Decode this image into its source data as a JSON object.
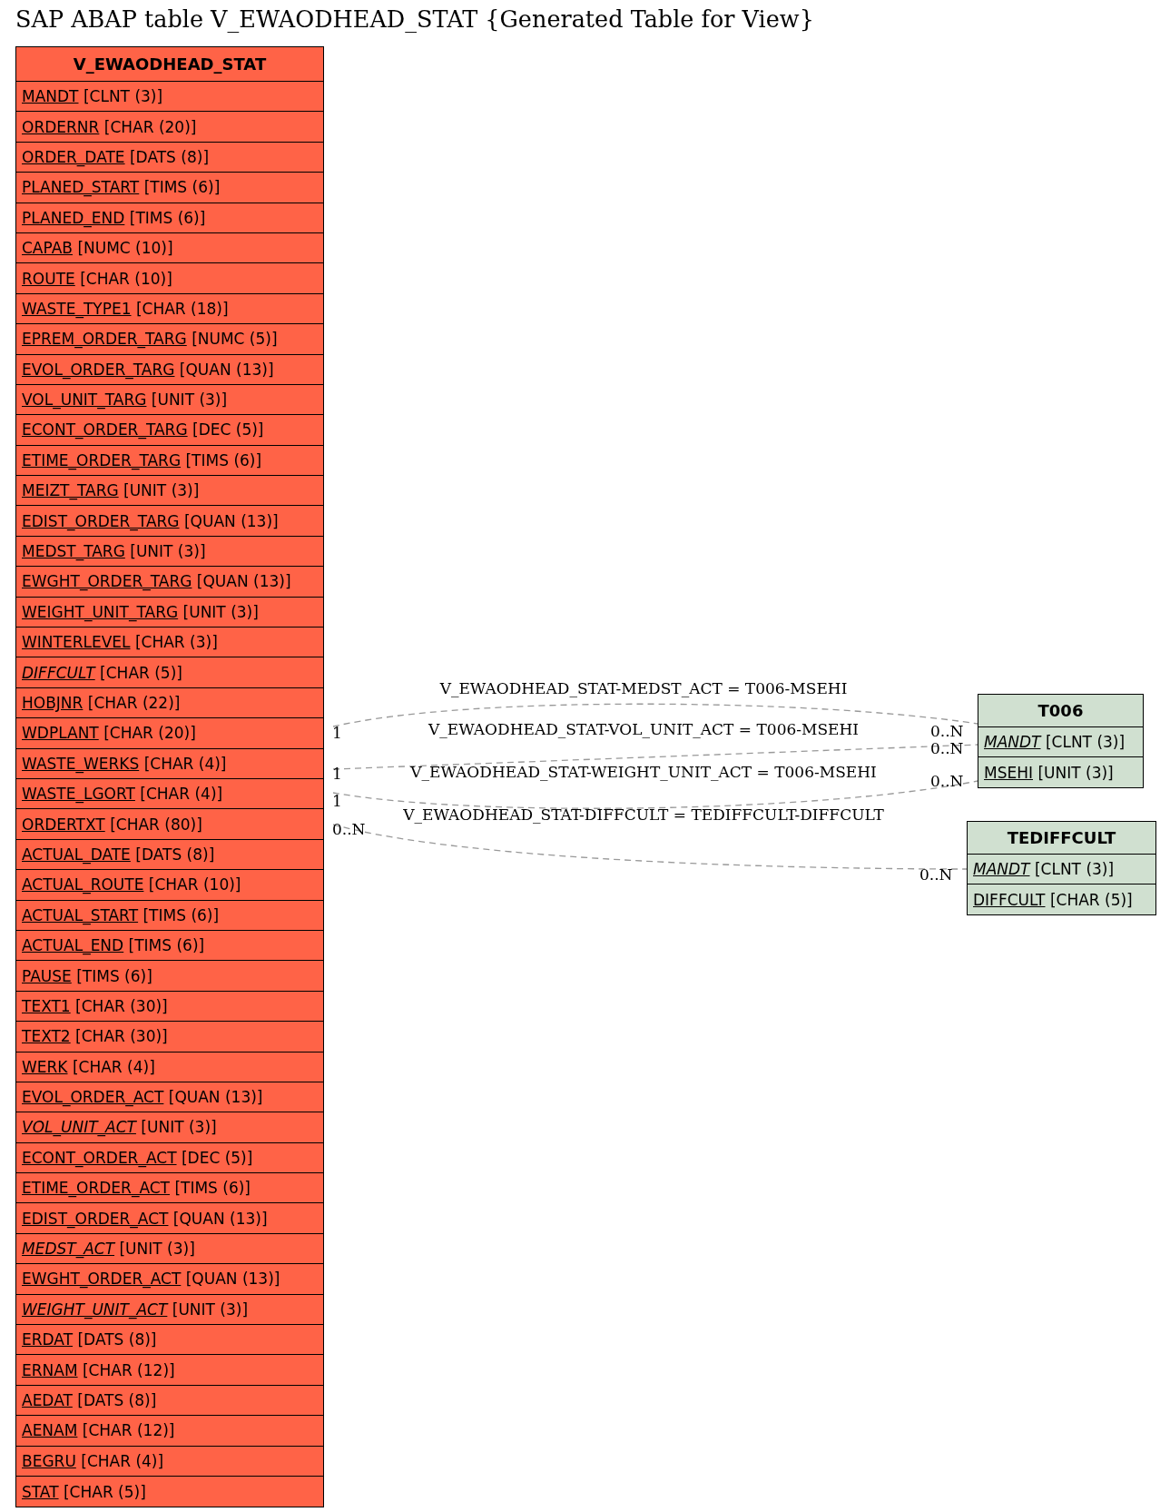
{
  "title": "SAP ABAP table V_EWAODHEAD_STAT {Generated Table for View}",
  "main_table": {
    "name": "V_EWAODHEAD_STAT",
    "fields": [
      {
        "name": "MANDT",
        "type": "[CLNT (3)]",
        "italic": false
      },
      {
        "name": "ORDERNR",
        "type": "[CHAR (20)]",
        "italic": false
      },
      {
        "name": "ORDER_DATE",
        "type": "[DATS (8)]",
        "italic": false
      },
      {
        "name": "PLANED_START",
        "type": "[TIMS (6)]",
        "italic": false
      },
      {
        "name": "PLANED_END",
        "type": "[TIMS (6)]",
        "italic": false
      },
      {
        "name": "CAPAB",
        "type": "[NUMC (10)]",
        "italic": false
      },
      {
        "name": "ROUTE",
        "type": "[CHAR (10)]",
        "italic": false
      },
      {
        "name": "WASTE_TYPE1",
        "type": "[CHAR (18)]",
        "italic": false
      },
      {
        "name": "EPREM_ORDER_TARG",
        "type": "[NUMC (5)]",
        "italic": false
      },
      {
        "name": "EVOL_ORDER_TARG",
        "type": "[QUAN (13)]",
        "italic": false
      },
      {
        "name": "VOL_UNIT_TARG",
        "type": "[UNIT (3)]",
        "italic": false
      },
      {
        "name": "ECONT_ORDER_TARG",
        "type": "[DEC (5)]",
        "italic": false
      },
      {
        "name": "ETIME_ORDER_TARG",
        "type": "[TIMS (6)]",
        "italic": false
      },
      {
        "name": "MEIZT_TARG",
        "type": "[UNIT (3)]",
        "italic": false
      },
      {
        "name": "EDIST_ORDER_TARG",
        "type": "[QUAN (13)]",
        "italic": false
      },
      {
        "name": "MEDST_TARG",
        "type": "[UNIT (3)]",
        "italic": false
      },
      {
        "name": "EWGHT_ORDER_TARG",
        "type": "[QUAN (13)]",
        "italic": false
      },
      {
        "name": "WEIGHT_UNIT_TARG",
        "type": "[UNIT (3)]",
        "italic": false
      },
      {
        "name": "WINTERLEVEL",
        "type": "[CHAR (3)]",
        "italic": false
      },
      {
        "name": "DIFFCULT",
        "type": "[CHAR (5)]",
        "italic": true
      },
      {
        "name": "HOBJNR",
        "type": "[CHAR (22)]",
        "italic": false
      },
      {
        "name": "WDPLANT",
        "type": "[CHAR (20)]",
        "italic": false
      },
      {
        "name": "WASTE_WERKS",
        "type": "[CHAR (4)]",
        "italic": false
      },
      {
        "name": "WASTE_LGORT",
        "type": "[CHAR (4)]",
        "italic": false
      },
      {
        "name": "ORDERTXT",
        "type": "[CHAR (80)]",
        "italic": false
      },
      {
        "name": "ACTUAL_DATE",
        "type": "[DATS (8)]",
        "italic": false
      },
      {
        "name": "ACTUAL_ROUTE",
        "type": "[CHAR (10)]",
        "italic": false
      },
      {
        "name": "ACTUAL_START",
        "type": "[TIMS (6)]",
        "italic": false
      },
      {
        "name": "ACTUAL_END",
        "type": "[TIMS (6)]",
        "italic": false
      },
      {
        "name": "PAUSE",
        "type": "[TIMS (6)]",
        "italic": false
      },
      {
        "name": "TEXT1",
        "type": "[CHAR (30)]",
        "italic": false
      },
      {
        "name": "TEXT2",
        "type": "[CHAR (30)]",
        "italic": false
      },
      {
        "name": "WERK",
        "type": "[CHAR (4)]",
        "italic": false
      },
      {
        "name": "EVOL_ORDER_ACT",
        "type": "[QUAN (13)]",
        "italic": false
      },
      {
        "name": "VOL_UNIT_ACT",
        "type": "[UNIT (3)]",
        "italic": true
      },
      {
        "name": "ECONT_ORDER_ACT",
        "type": "[DEC (5)]",
        "italic": false
      },
      {
        "name": "ETIME_ORDER_ACT",
        "type": "[TIMS (6)]",
        "italic": false
      },
      {
        "name": "EDIST_ORDER_ACT",
        "type": "[QUAN (13)]",
        "italic": false
      },
      {
        "name": "MEDST_ACT",
        "type": "[UNIT (3)]",
        "italic": true
      },
      {
        "name": "EWGHT_ORDER_ACT",
        "type": "[QUAN (13)]",
        "italic": false
      },
      {
        "name": "WEIGHT_UNIT_ACT",
        "type": "[UNIT (3)]",
        "italic": true
      },
      {
        "name": "ERDAT",
        "type": "[DATS (8)]",
        "italic": false
      },
      {
        "name": "ERNAM",
        "type": "[CHAR (12)]",
        "italic": false
      },
      {
        "name": "AEDAT",
        "type": "[DATS (8)]",
        "italic": false
      },
      {
        "name": "AENAM",
        "type": "[CHAR (12)]",
        "italic": false
      },
      {
        "name": "BEGRU",
        "type": "[CHAR (4)]",
        "italic": false
      },
      {
        "name": "STAT",
        "type": "[CHAR (5)]",
        "italic": false
      }
    ]
  },
  "related_tables": [
    {
      "name": "T006",
      "fields": [
        {
          "name": "MANDT",
          "type": "[CLNT (3)]",
          "italic": true
        },
        {
          "name": "MSEHI",
          "type": "[UNIT (3)]",
          "italic": false
        }
      ]
    },
    {
      "name": "TEDIFFCULT",
      "fields": [
        {
          "name": "MANDT",
          "type": "[CLNT (3)]",
          "italic": true
        },
        {
          "name": "DIFFCULT",
          "type": "[CHAR (5)]",
          "italic": false
        }
      ]
    }
  ],
  "relations": [
    {
      "label": "V_EWAODHEAD_STAT-MEDST_ACT = T006-MSEHI",
      "from_cardinality": "1",
      "to_cardinality": "0..N"
    },
    {
      "label": "V_EWAODHEAD_STAT-VOL_UNIT_ACT = T006-MSEHI",
      "from_cardinality": "1",
      "to_cardinality": "0..N"
    },
    {
      "label": "V_EWAODHEAD_STAT-WEIGHT_UNIT_ACT = T006-MSEHI",
      "from_cardinality": "1",
      "to_cardinality": "0..N"
    },
    {
      "label": "V_EWAODHEAD_STAT-DIFFCULT = TEDIFFCULT-DIFFCULT",
      "from_cardinality": "0..N",
      "to_cardinality": "0..N"
    }
  ]
}
